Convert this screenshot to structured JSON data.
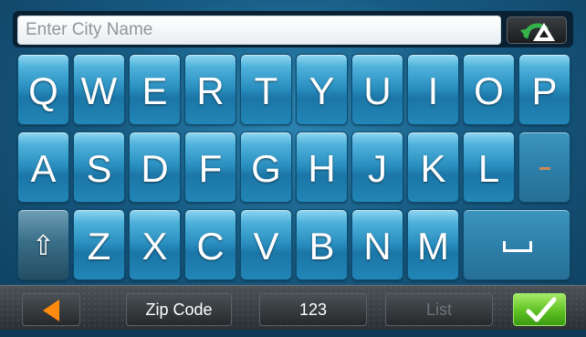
{
  "input": {
    "placeholder": "Enter City Name",
    "value": ""
  },
  "toolbar": {
    "back_icon": "back-arrow-icon"
  },
  "keyboard": {
    "row1": [
      "Q",
      "W",
      "E",
      "R",
      "T",
      "Y",
      "U",
      "I",
      "O",
      "P"
    ],
    "row2": [
      "A",
      "S",
      "D",
      "F",
      "G",
      "H",
      "J",
      "K",
      "L"
    ],
    "row3": [
      "Z",
      "X",
      "C",
      "V",
      "B",
      "N",
      "M"
    ],
    "shift_symbol": "⇧"
  },
  "bottom_bar": {
    "zip_code_label": "Zip Code",
    "numbers_label": "123",
    "list_label": "List"
  },
  "colors": {
    "accent": "#2a8fc0",
    "ok_green": "#5fc023",
    "back_orange": "#ff8a10"
  }
}
